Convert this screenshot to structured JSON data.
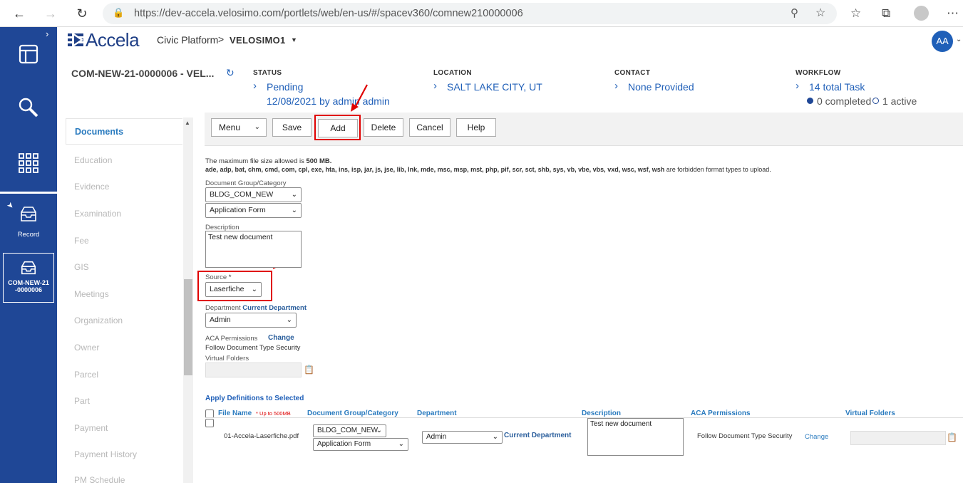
{
  "browser": {
    "url": "https://dev-accela.velosimo.com/portlets/web/en-us/#/spacev360/comnew210000006"
  },
  "nav": {
    "record_label": "Record",
    "active_record_label": "COM-NEW-21\n-0000006"
  },
  "header": {
    "brand": "Accela",
    "app": "Civic Platform",
    "separator": ">",
    "agency": "VELOSIMO1",
    "avatar": "AA"
  },
  "record": {
    "id": "COM-NEW-21-0000006 - VEL...",
    "status_label": "STATUS",
    "status": "Pending",
    "status_sub": "12/08/2021 by admin admin",
    "location_label": "LOCATION",
    "location": "SALT LAKE CITY, UT",
    "contact_label": "CONTACT",
    "contact": "None Provided",
    "workflow_label": "WORKFLOW",
    "workflow": "14 total Task",
    "completed": "0 completed",
    "active": "1 active"
  },
  "side_tabs": [
    "Documents",
    "Education",
    "Evidence",
    "Examination",
    "Fee",
    "GIS",
    "Meetings",
    "Organization",
    "Owner",
    "Parcel",
    "Part",
    "Payment",
    "Payment History",
    "PM Schedule"
  ],
  "toolbar": {
    "menu": "Menu",
    "save": "Save",
    "add": "Add",
    "delete": "Delete",
    "cancel": "Cancel",
    "help": "Help"
  },
  "form": {
    "max_size_prefix": "The maximum file size allowed is ",
    "max_size_value": "500 MB.",
    "forbidden_list": "ade, adp, bat, chm, cmd, com, cpl, exe, hta, ins, isp, jar, js, jse, lib, lnk, mde, msc, msp, mst, php, pif, scr, sct, shb, sys, vb, vbe, vbs, vxd, wsc, wsf, wsh",
    "forbidden_suffix": " are forbidden format types to upload.",
    "group_label": "Document Group/Category",
    "group_value": "BLDG_COM_NEW",
    "category_value": "Application Form",
    "description_label": "Description",
    "description_value": "Test new document",
    "source_label": "Source",
    "source_required": "*",
    "source_value": "Laserfiche",
    "department_label": "Department",
    "department_link": "Current Department",
    "department_value": "Admin",
    "aca_label": "ACA Permissions",
    "aca_change": "Change",
    "aca_value": "Follow Document Type Security",
    "virtual_folders_label": "Virtual Folders"
  },
  "apply": {
    "title": "Apply Definitions to Selected",
    "headers": {
      "file_name": "File Name",
      "file_note": "* Up to 500MB",
      "group": "Document Group/Category",
      "department": "Department",
      "description": "Description",
      "aca": "ACA Permissions",
      "virtual": "Virtual Folders"
    },
    "row": {
      "file": "01-Accela-Laserfiche.pdf",
      "group": "BLDG_COM_NEW",
      "category": "Application Form",
      "department": "Admin",
      "department_link": "Current Department",
      "description": "Test new document",
      "aca": "Follow Document Type Security",
      "aca_change": "Change"
    }
  }
}
